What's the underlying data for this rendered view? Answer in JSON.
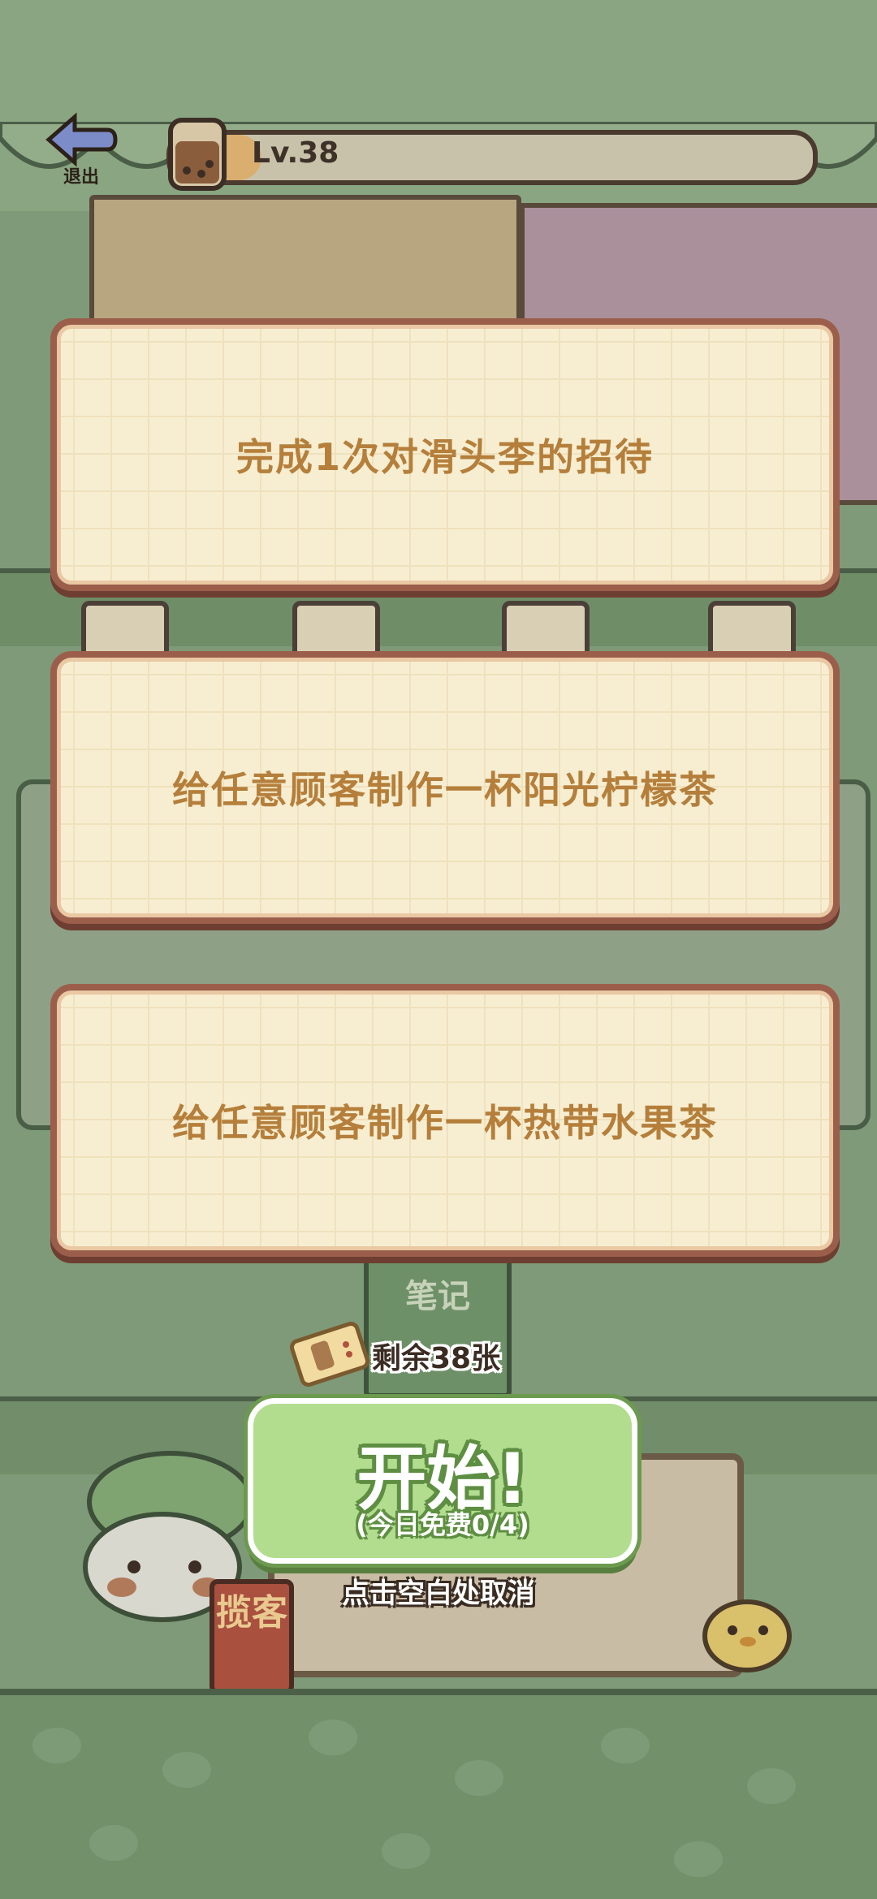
{
  "hud": {
    "exit_label": "退出",
    "level_text": "Lv.38",
    "level_progress": 0.02
  },
  "background": {
    "note_text": "笔记",
    "lanyard_text": "揽客"
  },
  "tasks": [
    {
      "label": "完成1次对滑头李的招待"
    },
    {
      "label": "给任意顾客制作一杯阳光柠檬茶"
    },
    {
      "label": "给任意顾客制作一杯热带水果茶"
    }
  ],
  "tickets": {
    "remaining_text": "剩余38张"
  },
  "start": {
    "label": "开始!",
    "sub_label": "(今日免费0/4)"
  },
  "cancel_hint": "点击空白处取消",
  "colors": {
    "card_text": "#b57f3b",
    "card_border": "#9b5e4b",
    "start_green": "#b2dd8e",
    "overlay_bg": "#7f9a78"
  }
}
